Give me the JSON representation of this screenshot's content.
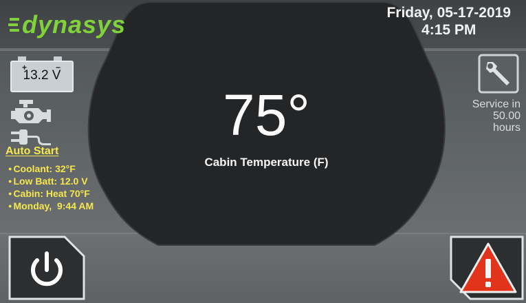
{
  "brand": {
    "logo_text": "dynasys",
    "accent": "#7fd23a"
  },
  "header": {
    "date": "Friday, 05-17-2019",
    "time": "4:15 PM"
  },
  "center": {
    "temperature": "75°",
    "label": "Cabin Temperature (F)"
  },
  "battery": {
    "voltage": "13.2 V",
    "terminals": [
      "+",
      "−"
    ]
  },
  "auto_start": {
    "title": "Auto Start",
    "items": [
      "Coolant: 32°F",
      "Low Batt: 12.0 V",
      "Cabin: Heat 70°F",
      "Monday,  9:44 AM"
    ]
  },
  "service": {
    "line1": "Service in",
    "line2": "50.00",
    "line3": "hours"
  },
  "icons": {
    "battery": "battery-icon",
    "engine": "engine-icon",
    "plug": "plug-icon",
    "wrench": "wrench-icon",
    "power": "power-icon",
    "alert": "warning-icon"
  },
  "colors": {
    "auto_start_text": "#f5e74d",
    "warning_red": "#e2331b",
    "center_panel": "#242526"
  }
}
